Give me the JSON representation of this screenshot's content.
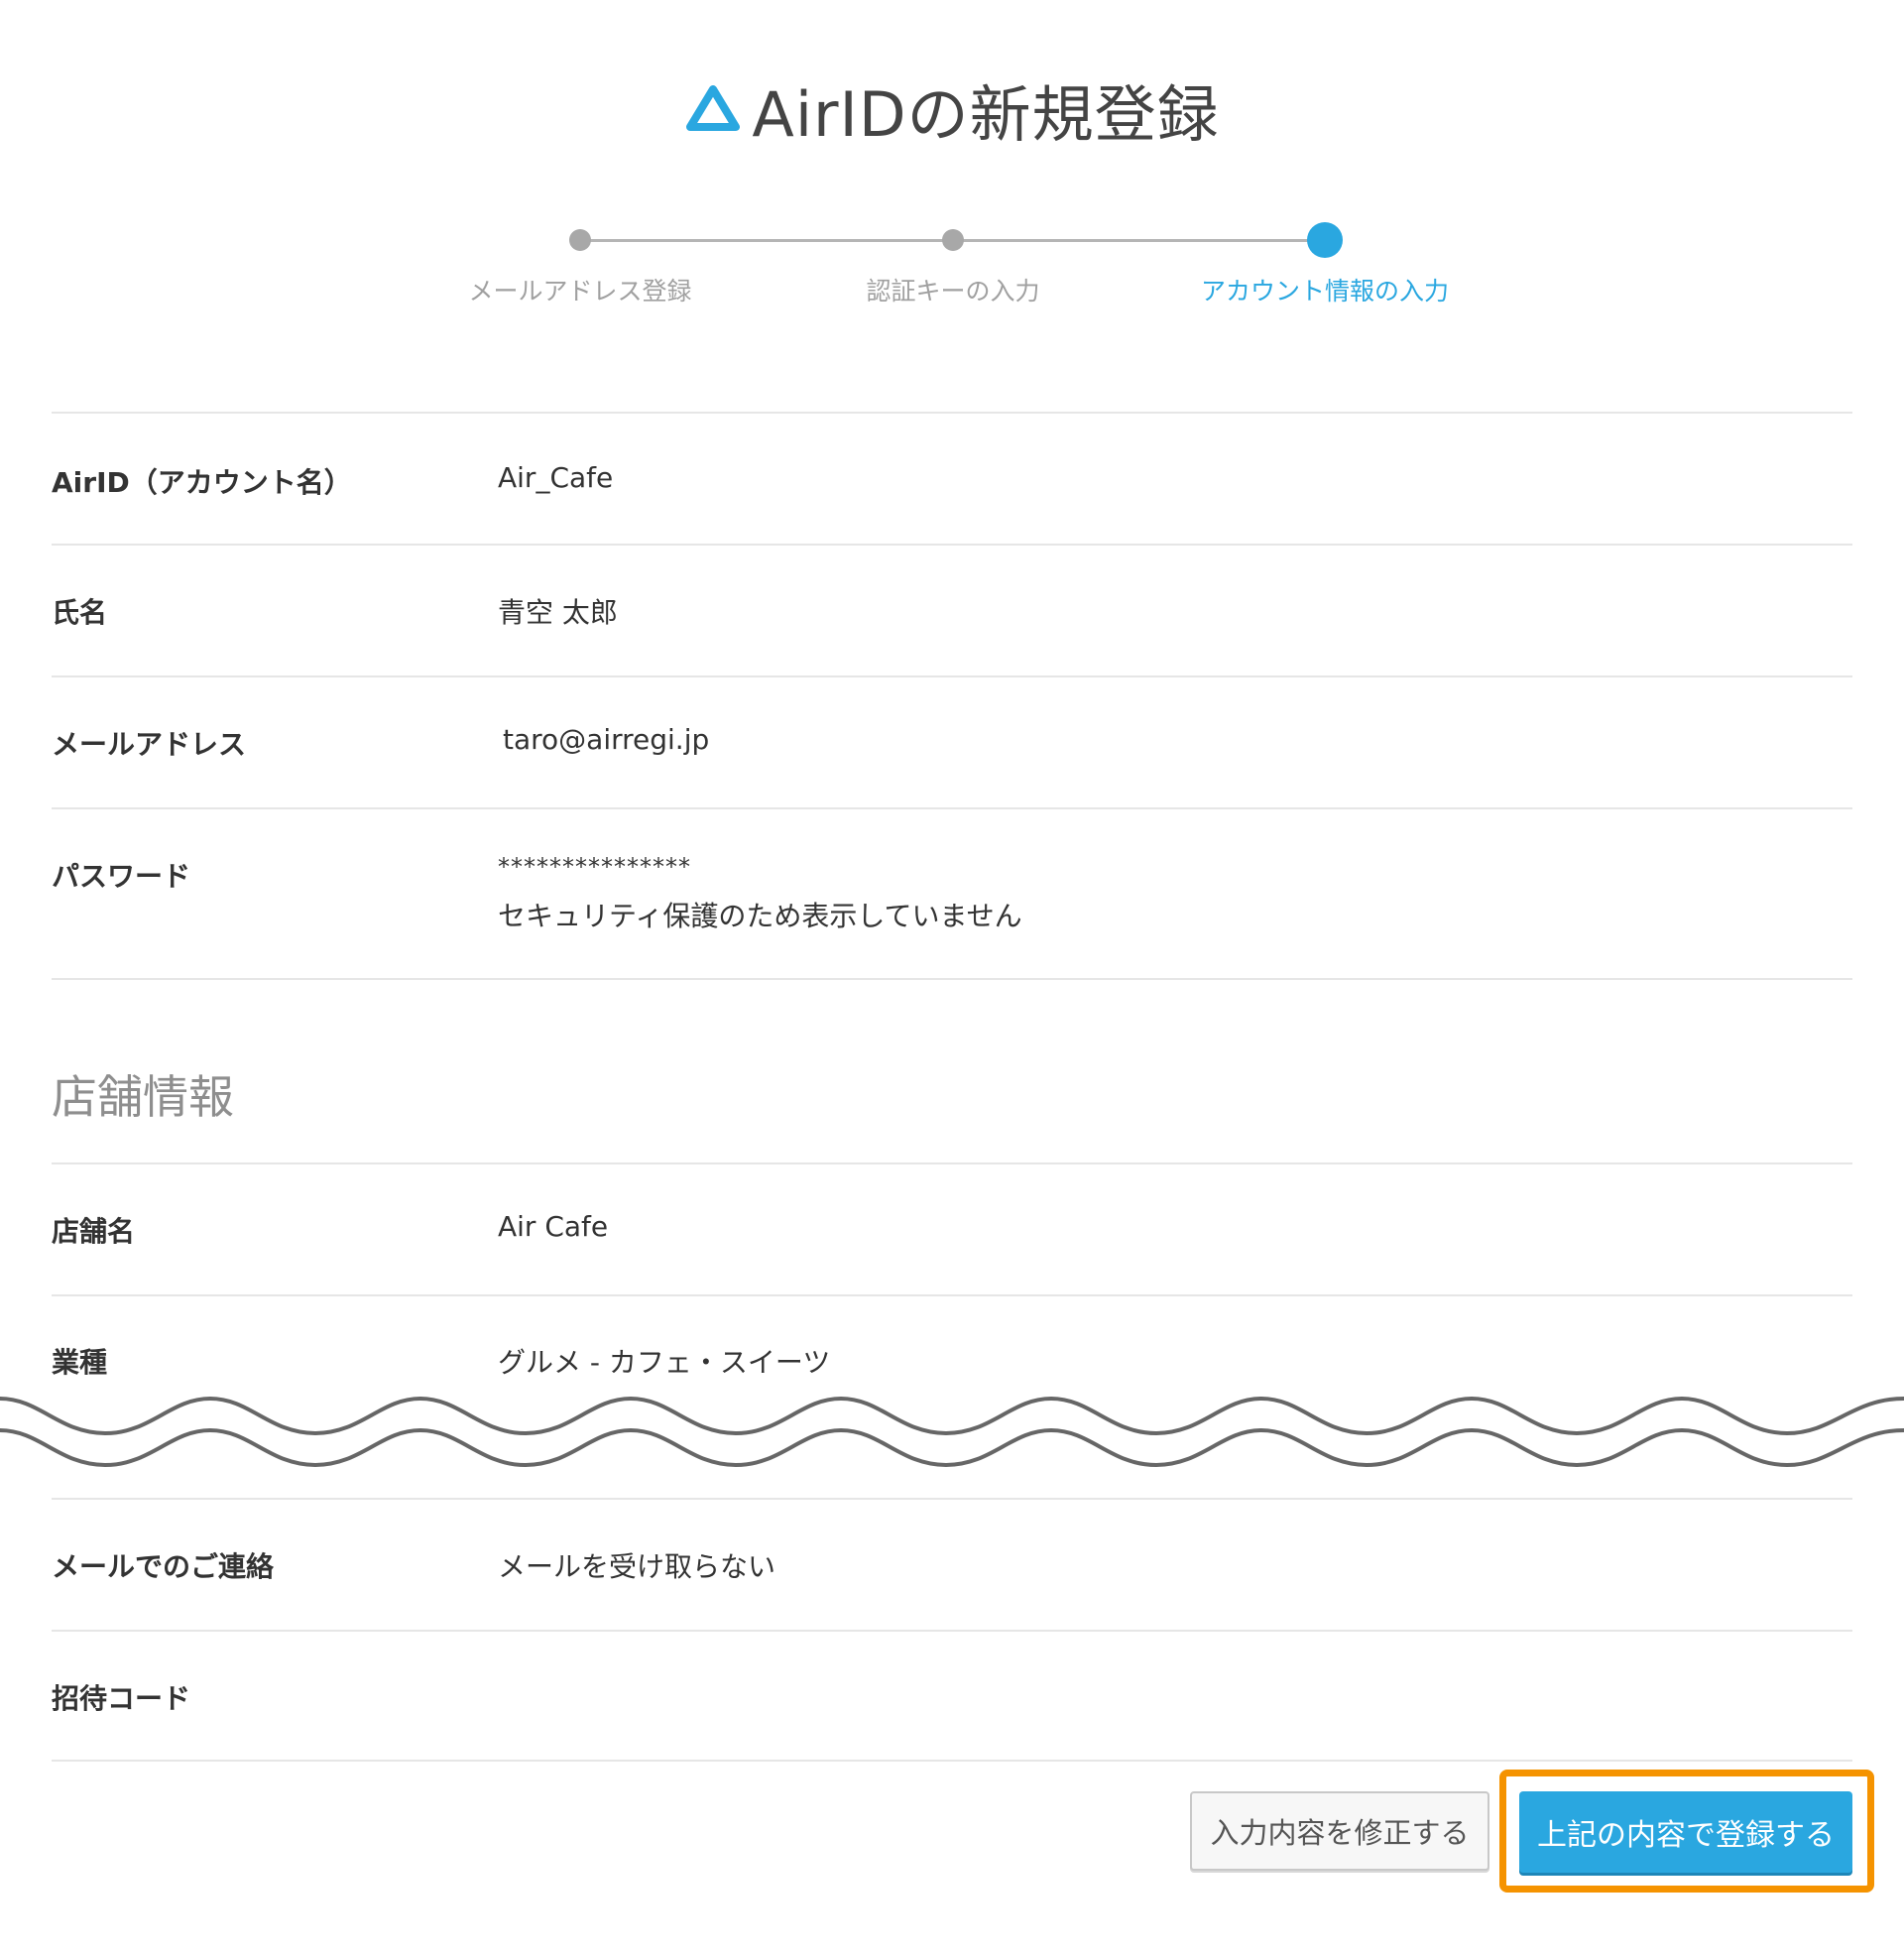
{
  "header": {
    "title": "AirIDの新規登録",
    "accent_color": "#2aa7e0"
  },
  "stepper": {
    "steps": [
      {
        "label": "メールアドレス登録",
        "state": "done"
      },
      {
        "label": "認証キーの入力",
        "state": "done"
      },
      {
        "label": "アカウント情報の入力",
        "state": "active"
      }
    ]
  },
  "account": {
    "rows": [
      {
        "label": "AirID（アカウント名）",
        "value": "Air_Cafe"
      },
      {
        "label": "氏名",
        "value": "青空 太郎"
      },
      {
        "label": "メールアドレス",
        "value": "taro@airregi.jp"
      },
      {
        "label": "パスワード",
        "masked": "***************",
        "note": "セキュリティ保護のため表示していません"
      }
    ]
  },
  "shop": {
    "heading": "店舗情報",
    "rows": [
      {
        "label": "店舗名",
        "value": "Air Cafe"
      },
      {
        "label": "業種",
        "value": "グルメ - カフェ・スイーツ"
      }
    ]
  },
  "extra": {
    "rows": [
      {
        "label": "メールでのご連絡",
        "value": "メールを受け取らない"
      },
      {
        "label": "招待コード",
        "value": ""
      }
    ]
  },
  "actions": {
    "edit_label": "入力内容を修正する",
    "submit_label": "上記の内容で登録する",
    "highlight_color": "#f59300"
  }
}
